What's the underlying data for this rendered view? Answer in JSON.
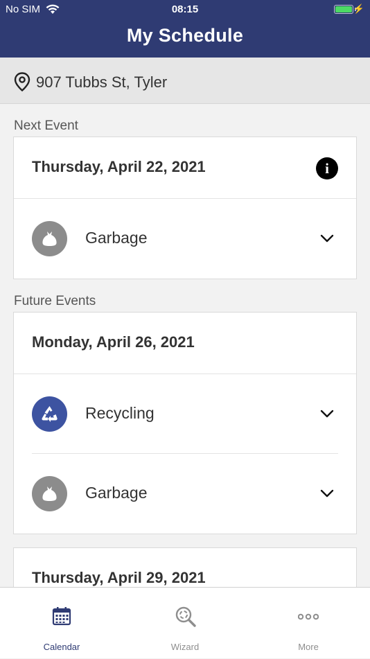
{
  "status_bar": {
    "carrier": "No SIM",
    "time": "08:15"
  },
  "header": {
    "title": "My Schedule"
  },
  "address": {
    "text": "907 Tubbs St, Tyler"
  },
  "next_event": {
    "section_label": "Next Event",
    "date": "Thursday, April 22, 2021",
    "events": [
      {
        "type": "garbage",
        "label": "Garbage"
      }
    ]
  },
  "future_events": {
    "section_label": "Future Events",
    "days": [
      {
        "date": "Monday, April 26, 2021",
        "events": [
          {
            "type": "recycling",
            "label": "Recycling"
          },
          {
            "type": "garbage",
            "label": "Garbage"
          }
        ]
      },
      {
        "date": "Thursday, April 29, 2021",
        "events": []
      }
    ]
  },
  "tabs": [
    {
      "label": "Calendar",
      "icon": "calendar-icon",
      "active": true
    },
    {
      "label": "Wizard",
      "icon": "wizard-search-icon",
      "active": false
    },
    {
      "label": "More",
      "icon": "more-dots-icon",
      "active": false
    }
  ],
  "colors": {
    "header": "#2f3b73",
    "recycling": "#3d53a1",
    "garbage": "#8c8c8c",
    "battery": "#4cd964"
  }
}
